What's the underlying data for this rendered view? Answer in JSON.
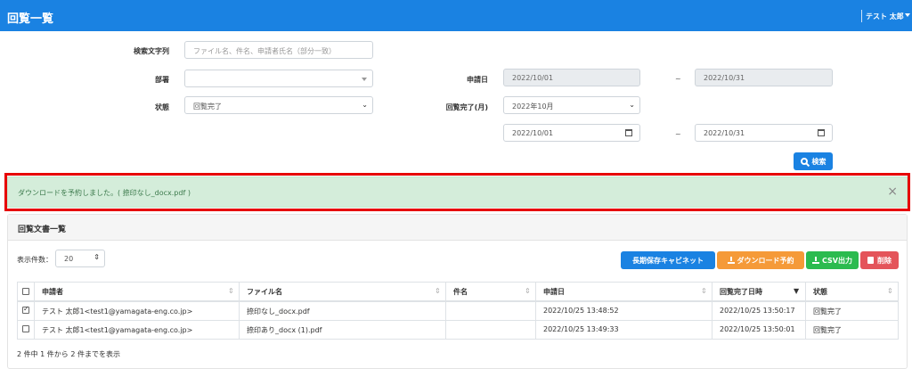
{
  "header": {
    "title": "回覧一覧",
    "user": "テスト 太郎"
  },
  "search": {
    "keyword_label": "検索文字列",
    "keyword_placeholder": "ファイル名、件名、申請者氏名（部分一致）",
    "department_label": "部署",
    "department_value": "",
    "status_label": "状態",
    "status_value": "回覧完了",
    "applied_label": "申請日",
    "applied_from": "2022/10/01",
    "applied_to": "2022/10/31",
    "completed_label": "回覧完了(月)",
    "completed_month": "2022年10月",
    "completed_from": "2022/10/01",
    "completed_to": "2022/10/31",
    "tilde": "~",
    "search_button": "検索"
  },
  "alert": {
    "message": "ダウンロードを予約しました。( 捺印なし_docx.pdf )",
    "close": "×"
  },
  "list": {
    "title": "回覧文書一覧",
    "page_size_label": "表示件数：",
    "page_size_value": "20",
    "buttons": {
      "cabinet": "長期保存キャビネット",
      "download": "ダウンロード予約",
      "csv": "CSV出力",
      "delete": "削除"
    },
    "columns": [
      "申請者",
      "ファイル名",
      "件名",
      "申請日",
      "回覧完了日時",
      "状態"
    ],
    "rows": [
      {
        "checked": true,
        "applicant": "テスト 太郎1<test1@yamagata-eng.co.jp>",
        "file": "捺印なし_docx.pdf",
        "subject": "",
        "applied": "2022/10/25 13:48:52",
        "completed": "2022/10/25 13:50:17",
        "status": "回覧完了"
      },
      {
        "checked": false,
        "applicant": "テスト 太郎1<test1@yamagata-eng.co.jp>",
        "file": "捺印あり_docx (1).pdf",
        "subject": "",
        "applied": "2022/10/25 13:49:33",
        "completed": "2022/10/25 13:50:01",
        "status": "回覧完了"
      }
    ],
    "footer": "2 件中 1 件から 2 件までを表示"
  }
}
